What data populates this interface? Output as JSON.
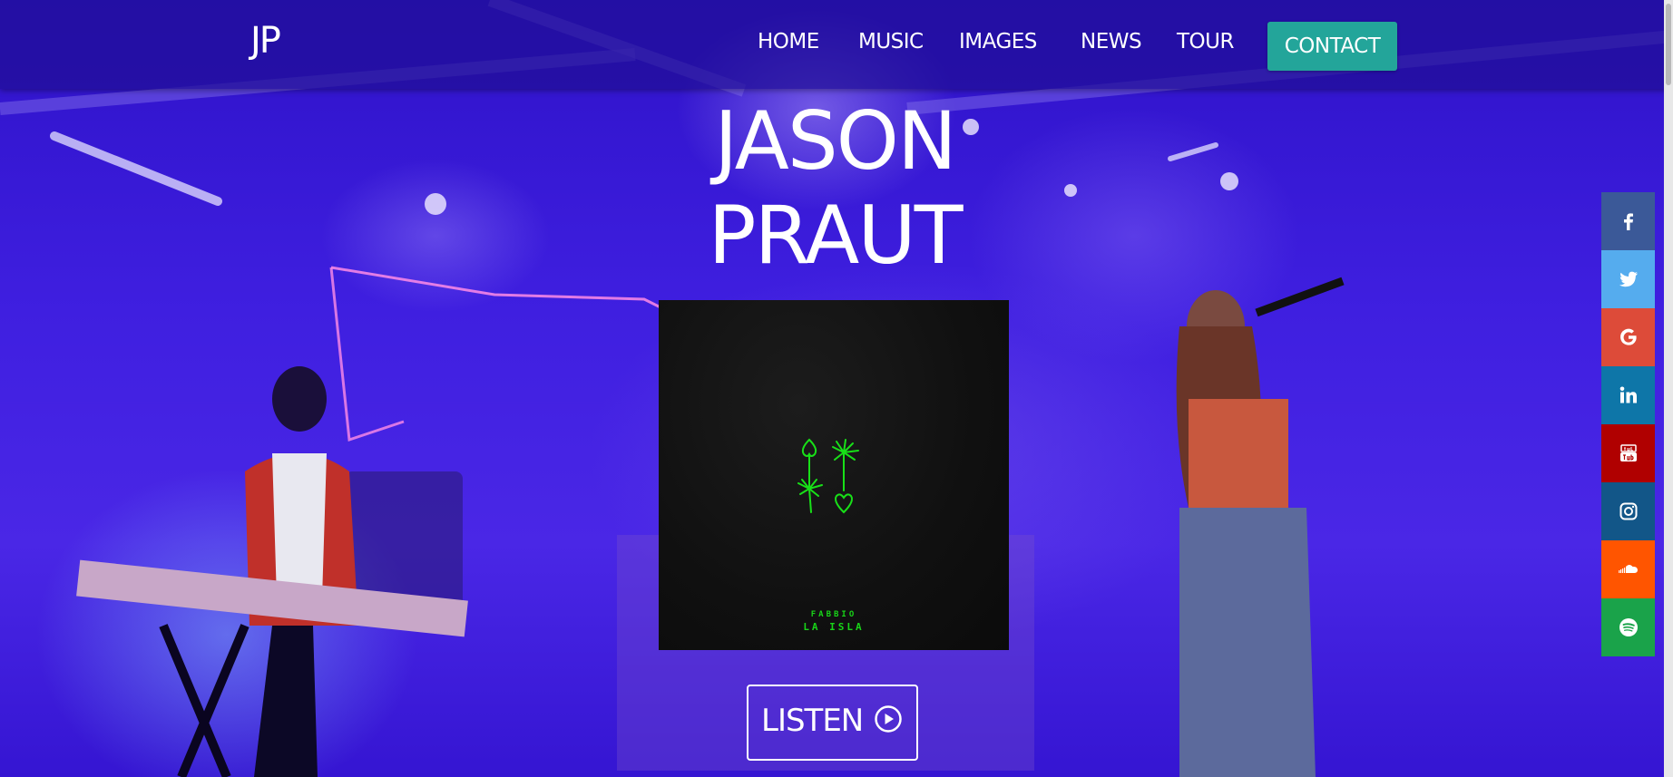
{
  "brand": {
    "logo": "JP"
  },
  "nav": {
    "items": [
      {
        "label": "HOME"
      },
      {
        "label": "MUSIC"
      },
      {
        "label": "IMAGES"
      },
      {
        "label": "NEWS"
      },
      {
        "label": "TOUR"
      }
    ],
    "contact_label": "CONTACT"
  },
  "hero": {
    "title_line1": "JASON",
    "title_line2": "PRAUT",
    "album": {
      "artist": "FABBIO",
      "name": "LA ISLA"
    },
    "listen_label": "LISTEN"
  },
  "social": [
    {
      "icon": "facebook-icon",
      "color": "#3b5998"
    },
    {
      "icon": "twitter-icon",
      "color": "#55acee"
    },
    {
      "icon": "google-icon",
      "color": "#dd4b39"
    },
    {
      "icon": "linkedin-icon",
      "color": "#0e76a8"
    },
    {
      "icon": "youtube-icon",
      "color": "#b00000"
    },
    {
      "icon": "instagram-icon",
      "color": "#125688"
    },
    {
      "icon": "soundcloud-icon",
      "color": "#ff5500"
    },
    {
      "icon": "spotify-icon",
      "color": "#1aa34a"
    }
  ],
  "colors": {
    "accent": "#23a59a",
    "album_text": "#18d418"
  }
}
